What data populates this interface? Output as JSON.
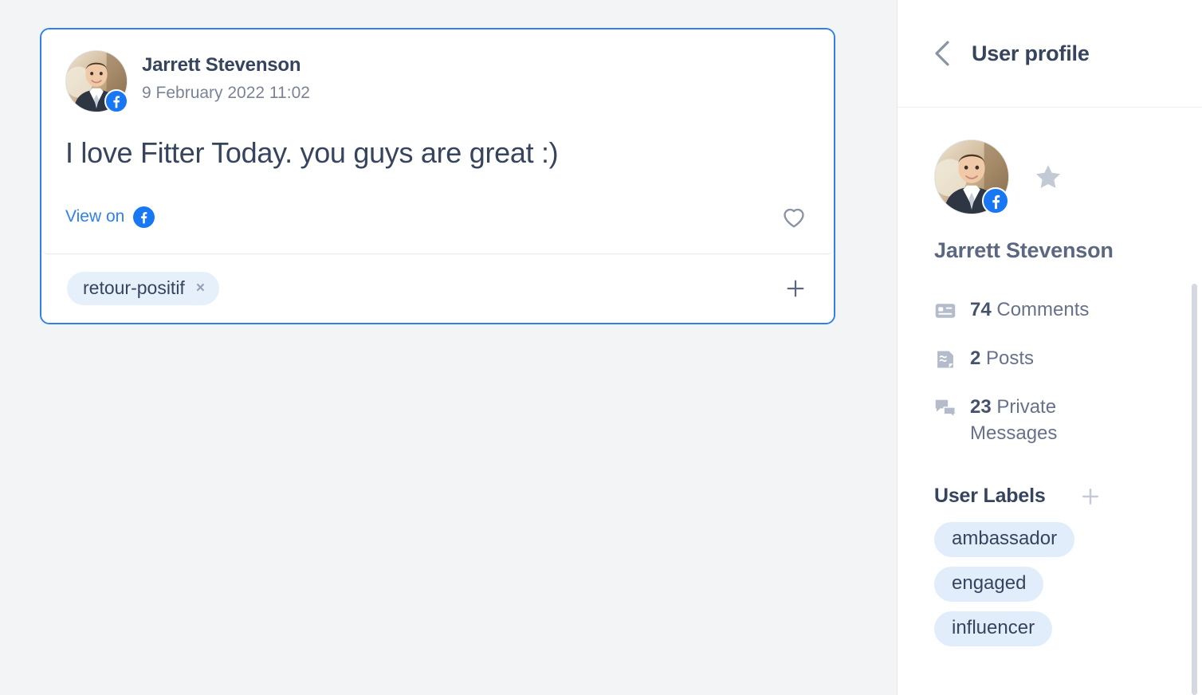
{
  "post": {
    "author": "Jarrett Stevenson",
    "date": "9 February 2022 11:02",
    "text": "I love Fitter Today. you guys are great :)",
    "view_on_label": "View on",
    "network": "facebook",
    "like_icon": "heart-icon",
    "tags": [
      {
        "label": "retour-positif",
        "remove": "×"
      }
    ],
    "add_tag_icon": "plus-icon"
  },
  "sidebar": {
    "back_icon": "chevron-left-icon",
    "title": "User profile",
    "profile": {
      "name": "Jarrett Stevenson",
      "favorite_icon": "star-icon",
      "network": "facebook"
    },
    "stats": [
      {
        "icon": "comment-card-icon",
        "count": "74",
        "label": "Comments"
      },
      {
        "icon": "post-document-icon",
        "count": "2",
        "label": "Posts"
      },
      {
        "icon": "private-message-icon",
        "count": "23",
        "label": "Private Messages"
      }
    ],
    "labels_section": {
      "title": "User Labels",
      "add_icon": "plus-icon",
      "labels": [
        "ambassador",
        "engaged",
        "influencer"
      ]
    }
  },
  "colors": {
    "accent_blue": "#2f80ed",
    "facebook_blue": "#1877f2",
    "text_navy": "#36445d",
    "text_muted": "#7b8496",
    "chip_bg": "#e6f0fb",
    "label_chip_bg": "#e1edfb",
    "page_bg": "#f3f4f6",
    "icon_gray": "#aeb6c4"
  }
}
